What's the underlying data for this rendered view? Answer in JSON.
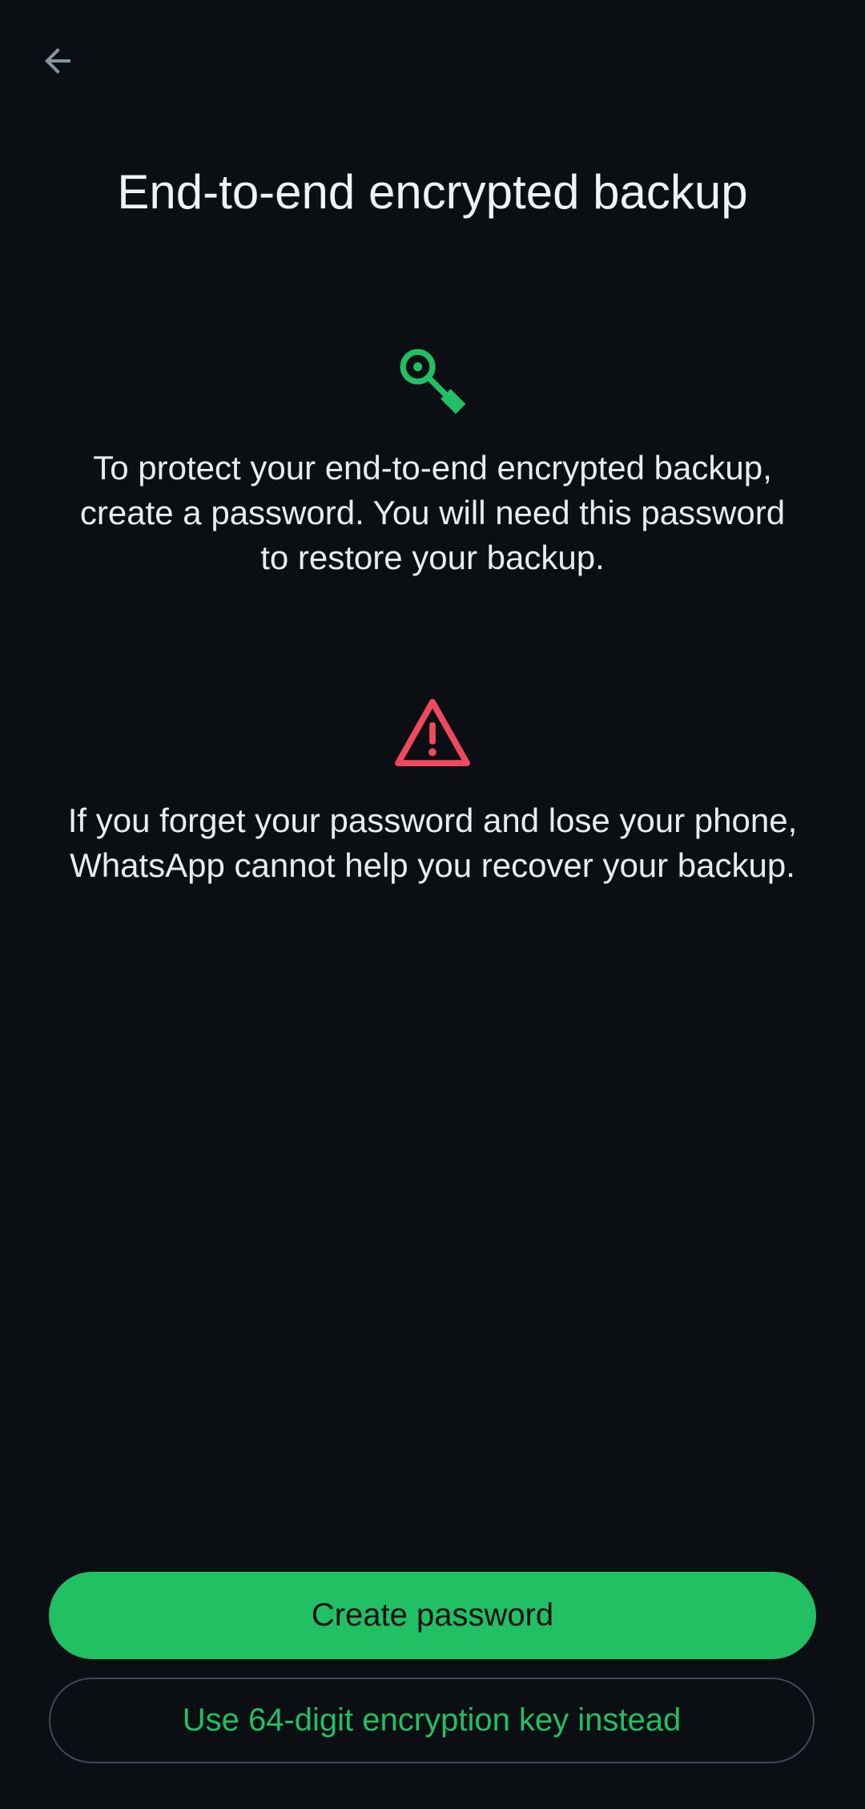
{
  "header": {
    "back_icon": "arrow-left-icon",
    "title": "End-to-end encrypted backup"
  },
  "sections": [
    {
      "icon": "key-icon",
      "icon_color": "#21c063",
      "text": "To protect your end-to-end encrypted backup, create a password. You will need this password to restore your backup."
    },
    {
      "icon": "warning-icon",
      "icon_color": "#f0495f",
      "text": "If you forget your password and lose your phone, WhatsApp cannot help you recover your backup."
    }
  ],
  "actions": {
    "primary_label": "Create password",
    "secondary_label": "Use 64-digit encryption key instead"
  },
  "colors": {
    "background": "#0b0f14",
    "accent": "#21c063",
    "warning": "#f0495f",
    "text": "#e9edef"
  }
}
